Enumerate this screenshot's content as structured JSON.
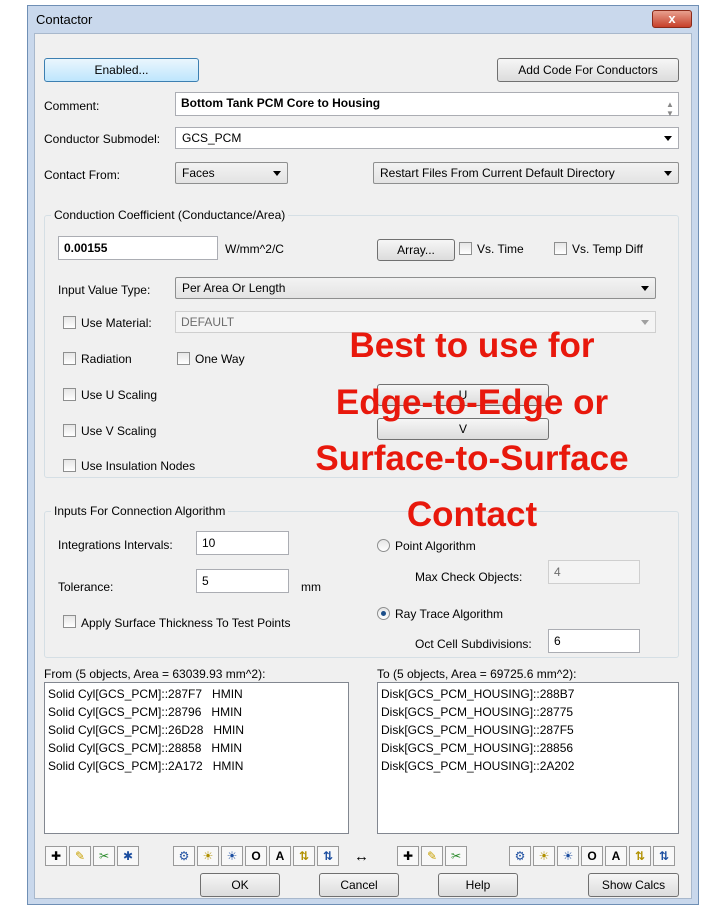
{
  "window": {
    "title": "Contactor",
    "close_label": "x"
  },
  "top": {
    "enabled_button": "Enabled...",
    "add_code_button": "Add Code For Conductors",
    "comment_label": "Comment:",
    "comment_value": "Bottom Tank PCM Core to Housing",
    "submodel_label": "Conductor Submodel:",
    "submodel_value": "GCS_PCM",
    "contact_from_label": "Contact From:",
    "contact_from_value": "Faces",
    "restart_value": "Restart Files From Current Default Directory"
  },
  "conduction": {
    "group_title": "Conduction Coefficient (Conductance/Area)",
    "value": "0.00155",
    "units": "W/mm^2/C",
    "array_button": "Array...",
    "vs_time_label": "Vs. Time",
    "vs_temp_label": "Vs. Temp Diff",
    "input_type_label": "Input Value Type:",
    "input_type_value": "Per Area Or Length",
    "use_material_label": "Use Material:",
    "material_value": "DEFAULT",
    "radiation_label": "Radiation",
    "one_way_label": "One Way",
    "use_u_scaling_label": "Use U Scaling",
    "use_v_scaling_label": "Use V Scaling",
    "u_button": "U",
    "v_button": "V",
    "insulation_label": "Use Insulation Nodes"
  },
  "connection": {
    "group_title": "Inputs For Connection Algorithm",
    "integrations_label": "Integrations Intervals:",
    "integrations_value": "10",
    "tolerance_label": "Tolerance:",
    "tolerance_value": "5",
    "tolerance_units": "mm",
    "thickness_label": "Apply Surface Thickness To Test Points",
    "point_algorithm_label": "Point Algorithm",
    "max_check_label": "Max Check Objects:",
    "max_check_value": "4",
    "ray_trace_label": "Ray Trace Algorithm",
    "oct_cell_label": "Oct Cell Subdivisions:",
    "oct_cell_value": "6"
  },
  "from_list": {
    "header": "From (5 objects, Area = 63039.93 mm^2):",
    "items": [
      "Solid Cyl[GCS_PCM]::287F7   HMIN",
      "Solid Cyl[GCS_PCM]::28796   HMIN",
      "Solid Cyl[GCS_PCM]::26D28   HMIN",
      "Solid Cyl[GCS_PCM]::28858   HMIN",
      "Solid Cyl[GCS_PCM]::2A172   HMIN"
    ]
  },
  "to_list": {
    "header": "To (5 objects, Area = 69725.6 mm^2):",
    "items": [
      "Disk[GCS_PCM_HOUSING]::288B7",
      "Disk[GCS_PCM_HOUSING]::28775",
      "Disk[GCS_PCM_HOUSING]::287F5",
      "Disk[GCS_PCM_HOUSING]::28856",
      "Disk[GCS_PCM_HOUSING]::2A202"
    ]
  },
  "toolbar": {
    "add_icon": "add-icon",
    "swap_arrow": "↔"
  },
  "footer": {
    "ok_button": "OK",
    "cancel_button": "Cancel",
    "help_button": "Help",
    "show_calcs_button": "Show Calcs"
  },
  "annotation": {
    "line1": "Best to use for",
    "line2": "Edge-to-Edge or",
    "line3": "Surface-to-Surface",
    "line4": "Contact",
    "color": "#e8180c"
  }
}
